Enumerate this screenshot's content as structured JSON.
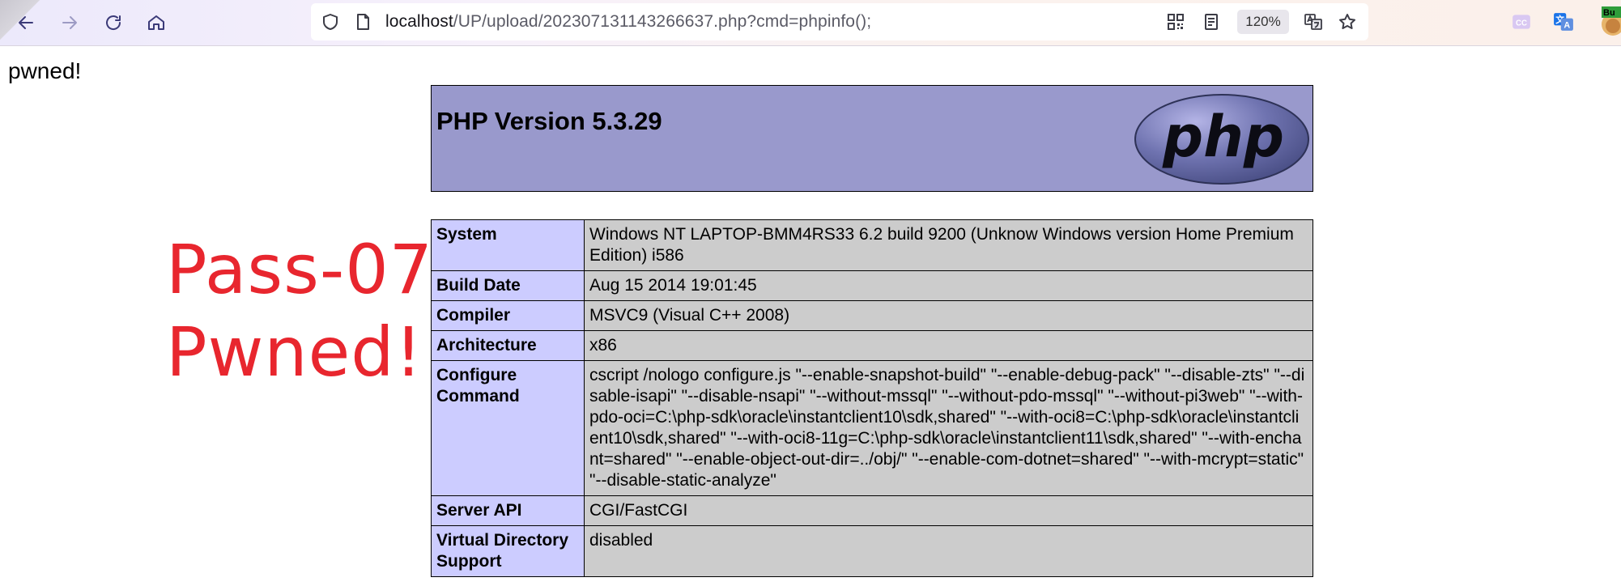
{
  "browser": {
    "url_host": "localhost",
    "url_path": "/UP/upload/202307131143266637.php?cmd=phpinfo();",
    "zoom": "120%",
    "extension_badge": "Bu"
  },
  "page": {
    "pwned_text": "pwned!",
    "overlay_line1": "Pass-07",
    "overlay_line2": "Pwned!",
    "php_version_title": "PHP Version 5.3.29",
    "logo_text": "php",
    "rows": [
      {
        "key": "System",
        "value": "Windows NT LAPTOP-BMM4RS33 6.2 build 9200 (Unknow Windows version Home Premium Edition) i586"
      },
      {
        "key": "Build Date",
        "value": "Aug 15 2014 19:01:45"
      },
      {
        "key": "Compiler",
        "value": "MSVC9 (Visual C++ 2008)"
      },
      {
        "key": "Architecture",
        "value": "x86"
      },
      {
        "key": "Configure Command",
        "value": "cscript /nologo configure.js \"--enable-snapshot-build\" \"--enable-debug-pack\" \"--disable-zts\" \"--disable-isapi\" \"--disable-nsapi\" \"--without-mssql\" \"--without-pdo-mssql\" \"--without-pi3web\" \"--with-pdo-oci=C:\\php-sdk\\oracle\\instantclient10\\sdk,shared\" \"--with-oci8=C:\\php-sdk\\oracle\\instantclient10\\sdk,shared\" \"--with-oci8-11g=C:\\php-sdk\\oracle\\instantclient11\\sdk,shared\" \"--with-enchant=shared\" \"--enable-object-out-dir=../obj/\" \"--enable-com-dotnet=shared\" \"--with-mcrypt=static\" \"--disable-static-analyze\""
      },
      {
        "key": "Server API",
        "value": "CGI/FastCGI"
      },
      {
        "key": "Virtual Directory Support",
        "value": "disabled"
      }
    ]
  },
  "colors": {
    "header_bg": "#9999cc",
    "key_bg": "#ccccff",
    "value_bg": "#cccccc",
    "overlay_red": "#e8262e"
  }
}
